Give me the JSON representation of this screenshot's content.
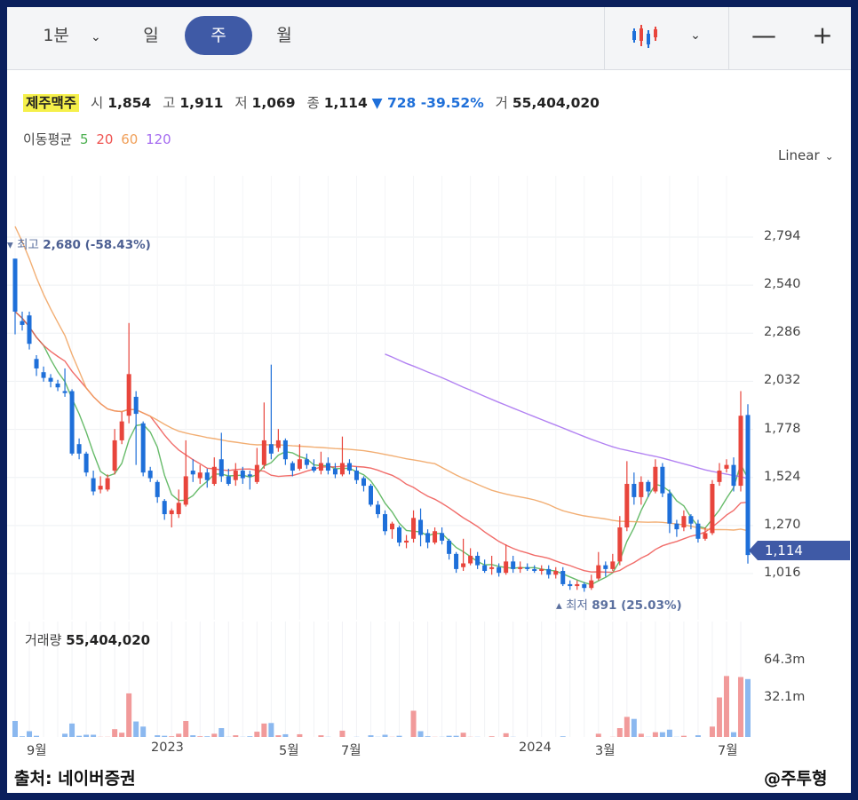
{
  "toolbar": {
    "interval": "1분",
    "tabs": [
      "일",
      "주",
      "월"
    ],
    "zoom_out": "—",
    "zoom_in": "+"
  },
  "quote": {
    "name": "제주맥주",
    "open_label": "시",
    "open": "1,854",
    "high_label": "고",
    "high": "1,911",
    "low_label": "저",
    "low": "1,069",
    "close_label": "종",
    "close": "1,114",
    "change": "▼ 728 -39.52%",
    "volume_label": "거",
    "volume": "55,404,020"
  },
  "moving_average": {
    "label": "이동평균",
    "periods": [
      {
        "value": "5",
        "color": "#4caf50"
      },
      {
        "value": "20",
        "color": "#ef5350"
      },
      {
        "value": "60",
        "color": "#f0a05a"
      },
      {
        "value": "120",
        "color": "#a56cf0"
      }
    ]
  },
  "scale_mode": "Linear",
  "y_ticks": [
    "2,794",
    "2,540",
    "2,286",
    "2,032",
    "1,778",
    "1,524",
    "1,270",
    "1,016"
  ],
  "current_price": "1,114",
  "high_marker": {
    "label": "최고",
    "value": "2,680 (-58.43%)"
  },
  "low_marker": {
    "label": "최저",
    "value": "891 (25.03%)"
  },
  "volume_panel": {
    "label": "거래량",
    "value": "55,404,020",
    "ticks": [
      "64.3m",
      "32.1m"
    ]
  },
  "x_ticks": [
    "9월",
    "2023",
    "5월",
    "7월",
    "2024",
    "3월",
    "7월"
  ],
  "footer": {
    "source": "출처: 네이버증권",
    "author": "@주투형"
  },
  "colors": {
    "up": "#e8453c",
    "down": "#1e6fd9",
    "accent": "#3f5aa6",
    "volume_up": "#f19a9a",
    "volume_down": "#8bb8ef"
  },
  "chart_data": {
    "type": "candlestick",
    "period": "weekly",
    "ylim": [
      891,
      2794
    ],
    "y_ticks": [
      2794,
      2540,
      2286,
      2032,
      1778,
      1524,
      1270,
      1016
    ],
    "candles": [
      [
        2680,
        2400,
        2680,
        2280
      ],
      [
        2350,
        2330,
        2400,
        2300
      ],
      [
        2380,
        2230,
        2400,
        2200
      ],
      [
        2150,
        2100,
        2170,
        2060
      ],
      [
        2080,
        2050,
        2110,
        2030
      ],
      [
        2050,
        2030,
        2070,
        2000
      ],
      [
        2020,
        2000,
        2040,
        1980
      ],
      [
        1980,
        1970,
        2100,
        1950
      ],
      [
        1980,
        1650,
        1990,
        1640
      ],
      [
        1700,
        1650,
        1730,
        1620
      ],
      [
        1650,
        1550,
        1660,
        1530
      ],
      [
        1520,
        1450,
        1560,
        1430
      ],
      [
        1460,
        1480,
        1530,
        1440
      ],
      [
        1460,
        1520,
        1540,
        1450
      ],
      [
        1560,
        1720,
        1780,
        1540
      ],
      [
        1720,
        1820,
        1870,
        1700
      ],
      [
        1850,
        2070,
        2340,
        1810
      ],
      [
        1950,
        1860,
        1980,
        1590
      ],
      [
        1810,
        1550,
        1820,
        1530
      ],
      [
        1560,
        1520,
        1580,
        1500
      ],
      [
        1500,
        1420,
        1510,
        1390
      ],
      [
        1400,
        1330,
        1410,
        1300
      ],
      [
        1330,
        1350,
        1360,
        1260
      ],
      [
        1330,
        1390,
        1460,
        1310
      ],
      [
        1380,
        1530,
        1720,
        1370
      ],
      [
        1560,
        1540,
        1620,
        1500
      ],
      [
        1520,
        1550,
        1590,
        1490
      ],
      [
        1550,
        1510,
        1570,
        1470
      ],
      [
        1490,
        1580,
        1630,
        1480
      ],
      [
        1620,
        1530,
        1760,
        1500
      ],
      [
        1530,
        1490,
        1570,
        1480
      ],
      [
        1510,
        1560,
        1600,
        1480
      ],
      [
        1560,
        1520,
        1580,
        1490
      ],
      [
        1540,
        1530,
        1560,
        1460
      ],
      [
        1500,
        1590,
        1680,
        1490
      ],
      [
        1590,
        1720,
        1920,
        1570
      ],
      [
        1700,
        1650,
        2120,
        1620
      ],
      [
        1680,
        1720,
        1780,
        1660
      ],
      [
        1720,
        1620,
        1730,
        1590
      ],
      [
        1600,
        1560,
        1610,
        1530
      ],
      [
        1570,
        1620,
        1700,
        1560
      ],
      [
        1620,
        1590,
        1650,
        1570
      ],
      [
        1580,
        1560,
        1620,
        1550
      ],
      [
        1560,
        1600,
        1660,
        1540
      ],
      [
        1600,
        1560,
        1630,
        1540
      ],
      [
        1570,
        1540,
        1600,
        1520
      ],
      [
        1540,
        1600,
        1740,
        1530
      ],
      [
        1600,
        1560,
        1620,
        1540
      ],
      [
        1560,
        1510,
        1580,
        1490
      ],
      [
        1520,
        1480,
        1530,
        1450
      ],
      [
        1480,
        1380,
        1490,
        1370
      ],
      [
        1380,
        1330,
        1400,
        1310
      ],
      [
        1330,
        1240,
        1350,
        1220
      ],
      [
        1250,
        1280,
        1290,
        1200
      ],
      [
        1260,
        1180,
        1270,
        1160
      ],
      [
        1180,
        1190,
        1220,
        1150
      ],
      [
        1200,
        1310,
        1350,
        1180
      ],
      [
        1300,
        1220,
        1360,
        1160
      ],
      [
        1230,
        1180,
        1250,
        1150
      ],
      [
        1180,
        1240,
        1260,
        1170
      ],
      [
        1230,
        1190,
        1260,
        1170
      ],
      [
        1190,
        1120,
        1200,
        1090
      ],
      [
        1120,
        1040,
        1130,
        1020
      ],
      [
        1050,
        1070,
        1200,
        1030
      ],
      [
        1070,
        1110,
        1150,
        1060
      ],
      [
        1110,
        1060,
        1130,
        1040
      ],
      [
        1060,
        1030,
        1090,
        1020
      ],
      [
        1040,
        1050,
        1110,
        1010
      ],
      [
        1050,
        1020,
        1070,
        1000
      ],
      [
        1020,
        1080,
        1170,
        1010
      ],
      [
        1080,
        1040,
        1110,
        1020
      ],
      [
        1040,
        1050,
        1080,
        1020
      ],
      [
        1050,
        1040,
        1070,
        1030
      ],
      [
        1040,
        1030,
        1060,
        1020
      ],
      [
        1030,
        1040,
        1060,
        1010
      ],
      [
        1040,
        1010,
        1060,
        990
      ],
      [
        1010,
        1030,
        1050,
        990
      ],
      [
        1030,
        960,
        1050,
        950
      ],
      [
        960,
        950,
        980,
        930
      ],
      [
        950,
        960,
        980,
        930
      ],
      [
        960,
        940,
        970,
        920
      ],
      [
        940,
        980,
        1010,
        930
      ],
      [
        990,
        1060,
        1130,
        980
      ],
      [
        1060,
        1040,
        1080,
        1000
      ],
      [
        1040,
        1080,
        1120,
        1030
      ],
      [
        1080,
        1260,
        1320,
        1060
      ],
      [
        1260,
        1490,
        1610,
        1240
      ],
      [
        1490,
        1420,
        1550,
        1380
      ],
      [
        1420,
        1500,
        1530,
        1380
      ],
      [
        1500,
        1450,
        1510,
        1420
      ],
      [
        1450,
        1580,
        1620,
        1440
      ],
      [
        1580,
        1440,
        1600,
        1420
      ],
      [
        1440,
        1280,
        1460,
        1230
      ],
      [
        1280,
        1250,
        1300,
        1210
      ],
      [
        1260,
        1320,
        1350,
        1240
      ],
      [
        1320,
        1280,
        1330,
        1250
      ],
      [
        1280,
        1200,
        1300,
        1180
      ],
      [
        1200,
        1230,
        1260,
        1190
      ],
      [
        1230,
        1490,
        1510,
        1220
      ],
      [
        1500,
        1560,
        1600,
        1480
      ],
      [
        1570,
        1590,
        1620,
        1550
      ],
      [
        1590,
        1480,
        1630,
        1450
      ],
      [
        1480,
        1850,
        1980,
        1450
      ],
      [
        1854,
        1114,
        1911,
        1069
      ]
    ],
    "ma_120_visible_from": "2023-08",
    "volume_ticks": [
      64.3,
      32.1
    ],
    "volume_unit": "m",
    "last_volume": 55404020
  }
}
